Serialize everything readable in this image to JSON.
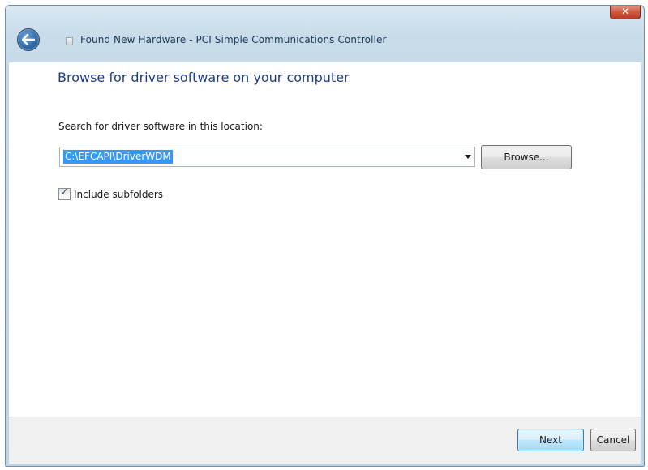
{
  "window": {
    "title": "Found New Hardware - PCI Simple Communications Controller",
    "close_glyph": "✕"
  },
  "page": {
    "heading": "Browse for driver software on your computer",
    "search_label": "Search for driver software in this location:",
    "path_value": "C:\\EFCAPI\\DriverWDM",
    "browse_label": "Browse...",
    "include_subfolders": {
      "label": "Include subfolders",
      "checked": true,
      "check_glyph": "✓"
    }
  },
  "footer": {
    "next_label": "Next",
    "cancel_label": "Cancel"
  },
  "icons": {
    "back": "back-arrow-icon",
    "title": "hardware-icon",
    "dropdown": "chevron-down-icon",
    "close": "close-icon"
  },
  "colors": {
    "heading": "#1f3d8c",
    "title_text": "#1e395b",
    "selection": "#3399ff",
    "close_button": "#cf5b43",
    "default_button_border": "#3c7fb1"
  }
}
